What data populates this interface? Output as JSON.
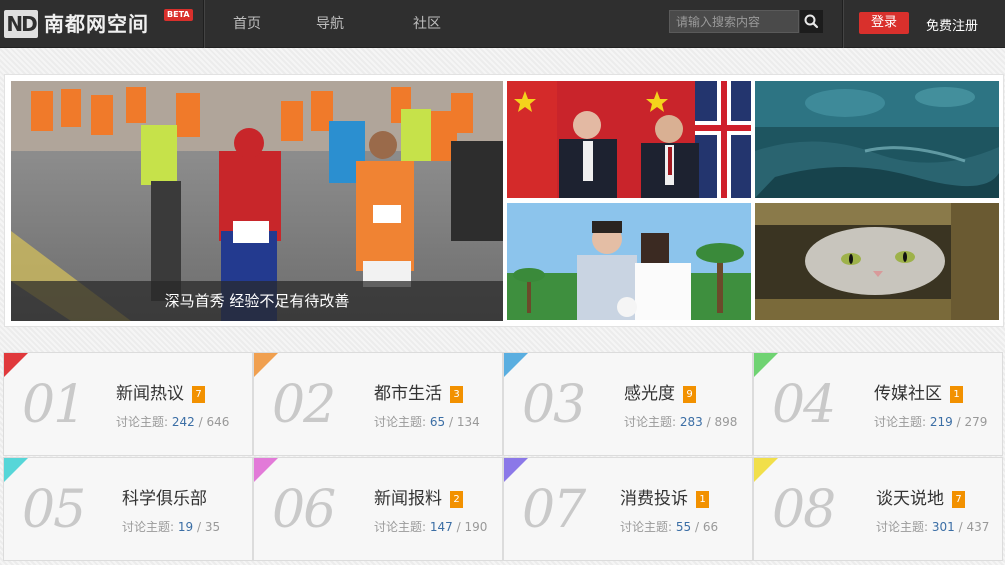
{
  "header": {
    "logo_mark": "ND",
    "site_name": "南都网空间",
    "beta_label": "BETA",
    "nav": [
      "首页",
      "导航",
      "社区"
    ],
    "search_placeholder": "请输入搜索内容",
    "login_label": "登录",
    "register_label": "免费注册"
  },
  "slideshow": {
    "main_caption": "深马首秀 经验不足有待改善"
  },
  "forums": {
    "stats_label": "讨论主题:",
    "separator": "/",
    "items": [
      {
        "num": "01",
        "name": "新闻热议",
        "badge": "7",
        "topics": "242",
        "posts": "646",
        "color": "#e0393c"
      },
      {
        "num": "02",
        "name": "都市生活",
        "badge": "3",
        "topics": "65",
        "posts": "134",
        "color": "#f0a050"
      },
      {
        "num": "03",
        "name": "感光度",
        "badge": "9",
        "topics": "283",
        "posts": "898",
        "color": "#5aaee0"
      },
      {
        "num": "04",
        "name": "传媒社区",
        "badge": "1",
        "topics": "219",
        "posts": "279",
        "color": "#6fd372"
      },
      {
        "num": "05",
        "name": "科学俱乐部",
        "badge": "",
        "topics": "19",
        "posts": "35",
        "color": "#56d6d8"
      },
      {
        "num": "06",
        "name": "新闻报料",
        "badge": "2",
        "topics": "147",
        "posts": "190",
        "color": "#e27ad8"
      },
      {
        "num": "07",
        "name": "消费投诉",
        "badge": "1",
        "topics": "55",
        "posts": "66",
        "color": "#8b78e8"
      },
      {
        "num": "08",
        "name": "谈天说地",
        "badge": "7",
        "topics": "301",
        "posts": "437",
        "color": "#f1df4a"
      }
    ]
  },
  "icons": {
    "search": "search-icon"
  }
}
